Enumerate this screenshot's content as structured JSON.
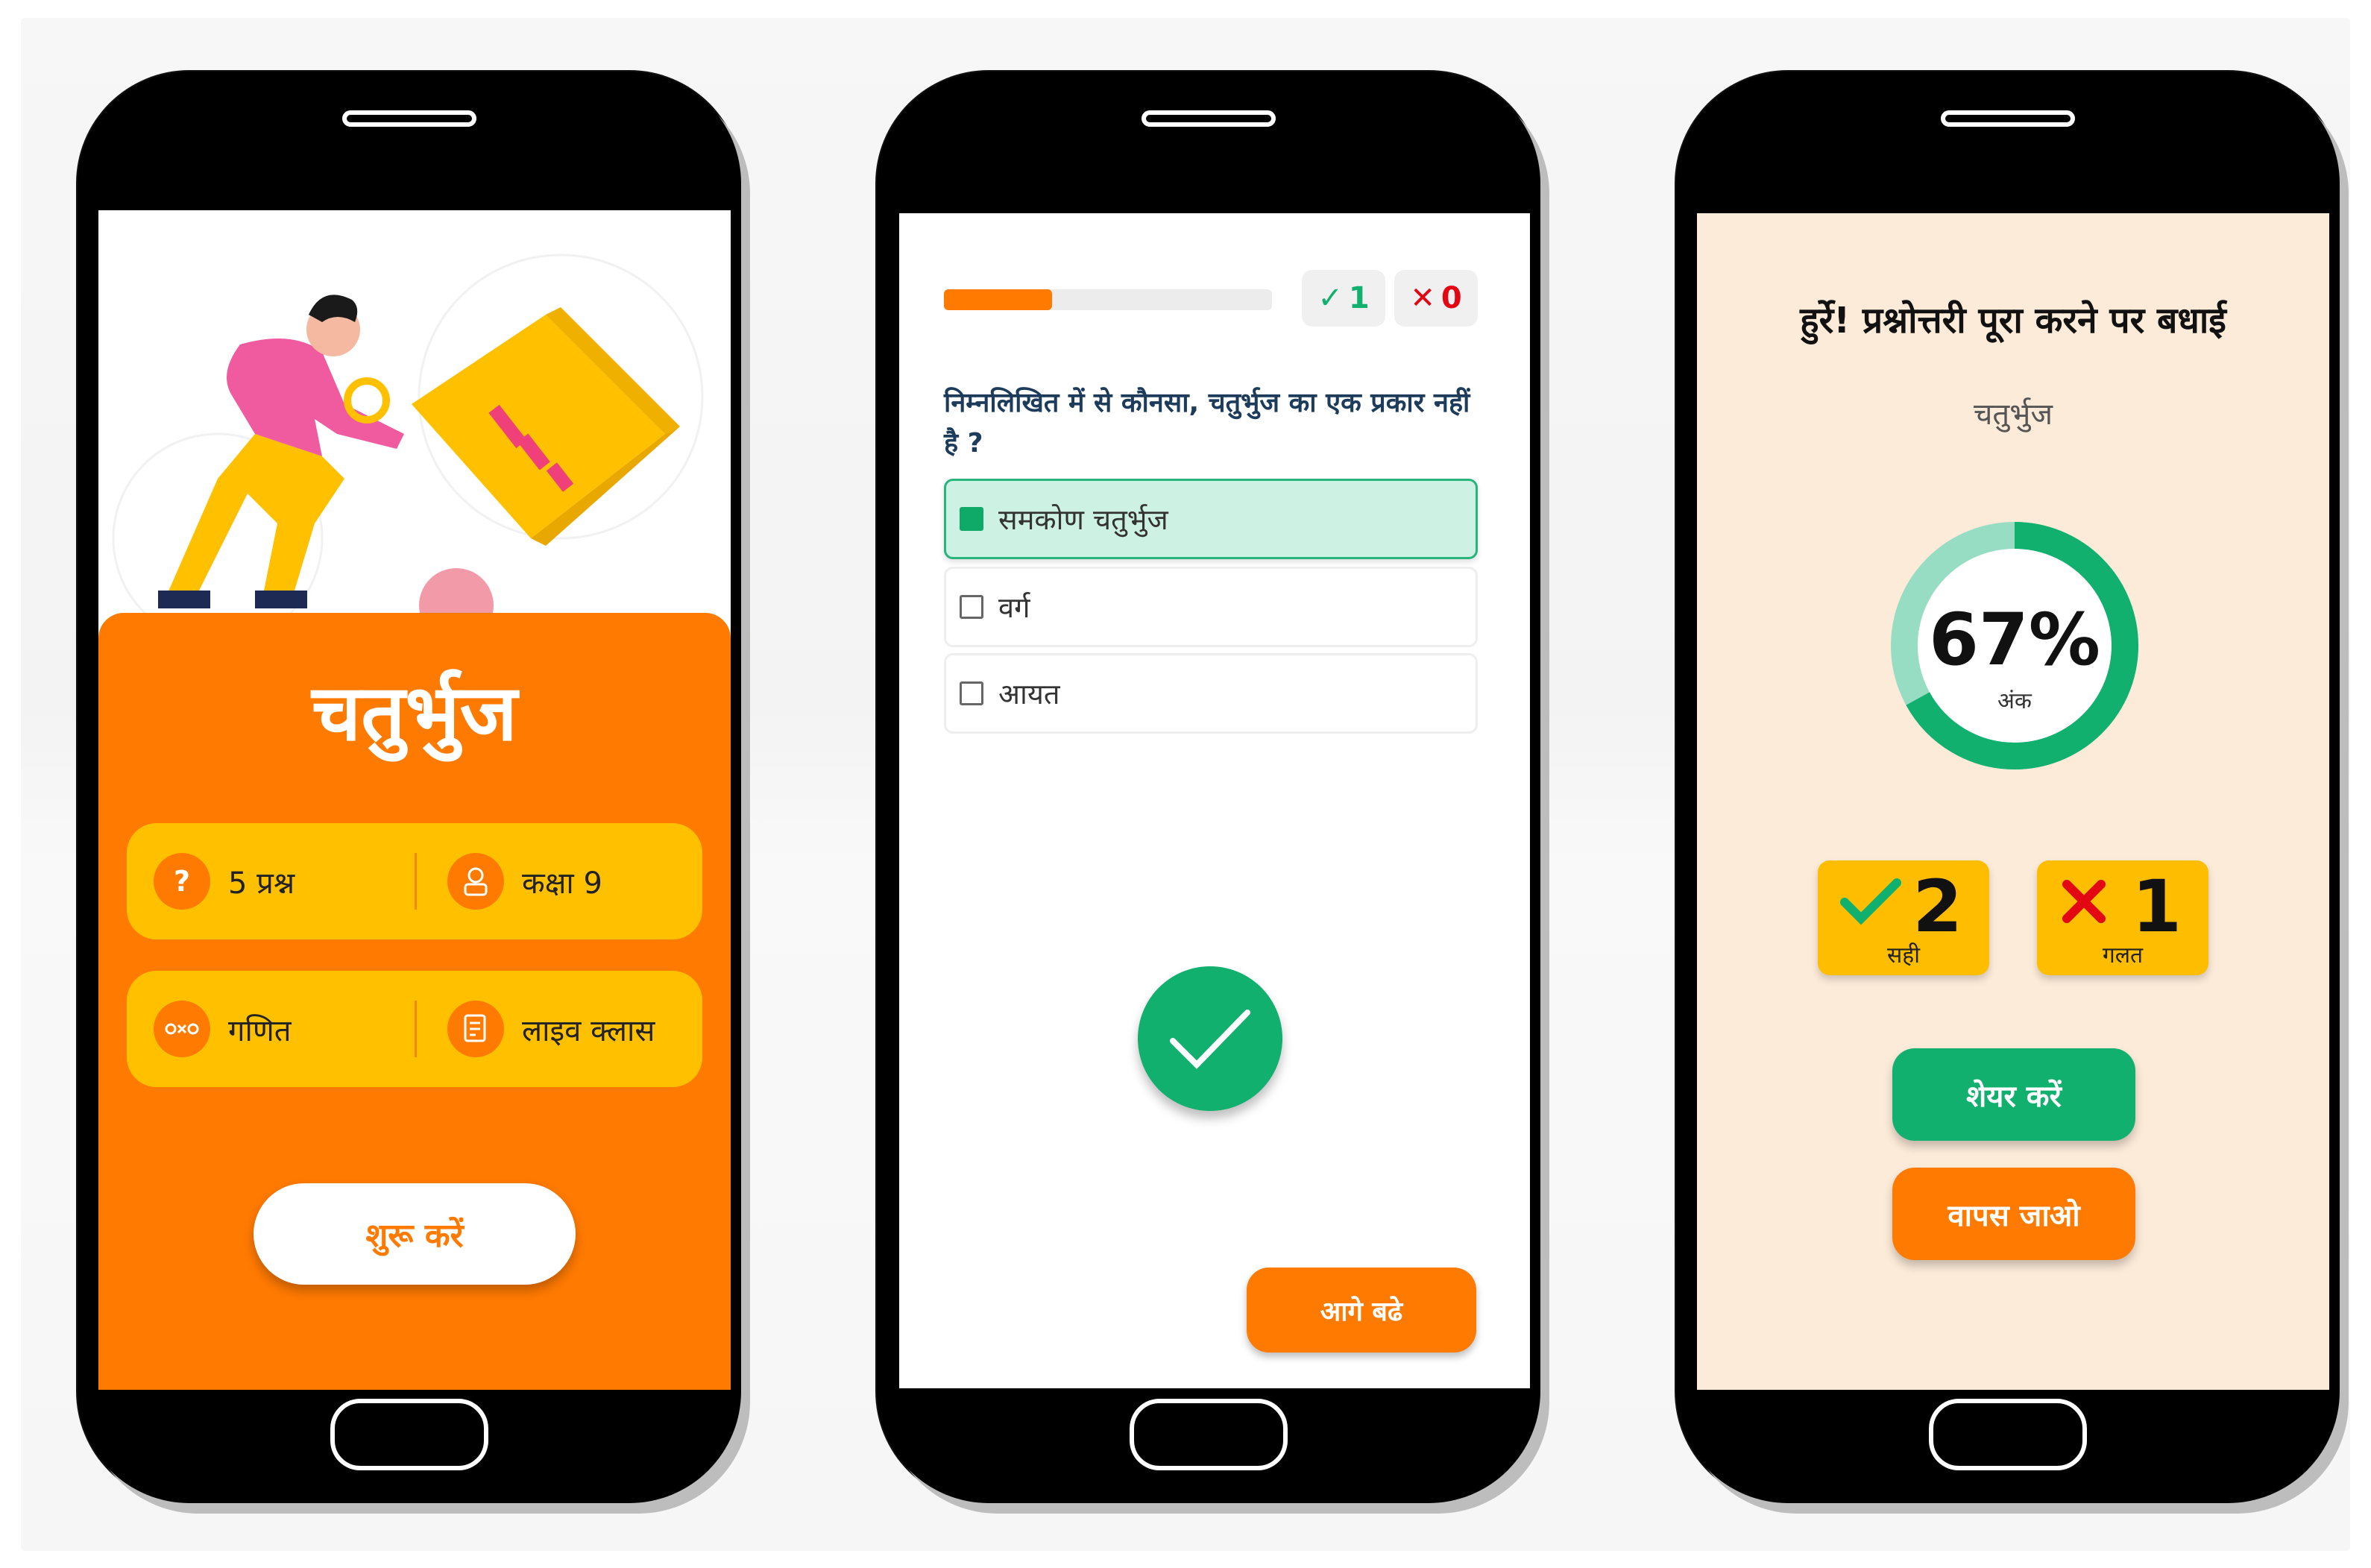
{
  "colors": {
    "orange": "#ff7a00",
    "yellow": "#ffc000",
    "green": "#12b06f",
    "peach": "#fdebd9",
    "red": "#e30613"
  },
  "intro_screen": {
    "title": "चतुर्भुज",
    "info": [
      {
        "icon": "question-icon",
        "icon_text": "?",
        "label": "5 प्रश्न"
      },
      {
        "icon": "student-icon",
        "icon_text": "",
        "label": "कक्षा 9"
      },
      {
        "icon": "math-icon",
        "icon_text": "",
        "label": "गणित"
      },
      {
        "icon": "live-class-icon",
        "icon_text": "",
        "label": "लाइव क्लास"
      }
    ],
    "start_label": "शुरू करें"
  },
  "question_screen": {
    "progress": 0.33,
    "correct_count": "1",
    "wrong_count": "0",
    "question": "निम्नलिखित में से कौनसा, चतुर्भुज का एक प्रकार नहीं है ?",
    "options": [
      {
        "label": "समकोण चतुर्भुज",
        "selected": true
      },
      {
        "label": "वर्ग",
        "selected": false
      },
      {
        "label": "आयत",
        "selected": false
      }
    ],
    "next_label": "आगे बढे"
  },
  "result_screen": {
    "congrats": "हुर्रे! प्रश्नोत्तरी पूरा करने पर बधाई",
    "subject": "चतुर्भुज",
    "score_percent": "67%",
    "score_fraction": 0.67,
    "score_label": "अंक",
    "correct": {
      "count": "2",
      "label": "सही"
    },
    "wrong": {
      "count": "1",
      "label": "गलत"
    },
    "share_label": "शेयर करें",
    "back_label": "वापस जाओ"
  }
}
